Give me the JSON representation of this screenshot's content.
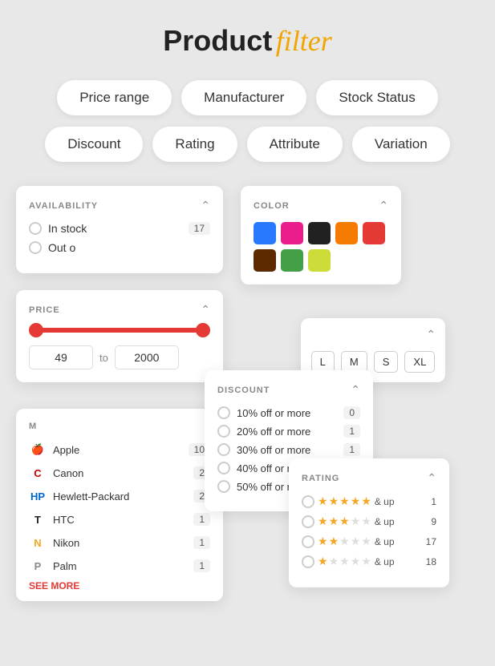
{
  "title": {
    "bold": "Product",
    "italic": "filter"
  },
  "pills_row1": [
    {
      "label": "Price range"
    },
    {
      "label": "Manufacturer"
    },
    {
      "label": "Stock Status"
    }
  ],
  "pills_row2": [
    {
      "label": "Discount"
    },
    {
      "label": "Rating"
    },
    {
      "label": "Attribute"
    },
    {
      "label": "Variation"
    }
  ],
  "availability": {
    "title": "AVAILABILITY",
    "items": [
      {
        "label": "In stock",
        "count": "17"
      },
      {
        "label": "Out of",
        "count": ""
      }
    ]
  },
  "price": {
    "title": "PRICE",
    "min": "49",
    "max": "2000"
  },
  "manufacturer": {
    "title": "M",
    "items": [
      {
        "logo_color": "#999",
        "logo_text": "🍎",
        "name": "Apple",
        "count": "10"
      },
      {
        "logo_color": "#c00",
        "logo_text": "C",
        "name": "Canon",
        "count": "2"
      },
      {
        "logo_color": "#0066cc",
        "logo_text": "HP",
        "name": "Hewlett-Packard",
        "count": "2"
      },
      {
        "logo_color": "#222",
        "logo_text": "T",
        "name": "HTC",
        "count": "1"
      },
      {
        "logo_color": "#f5a623",
        "logo_text": "N",
        "name": "Nikon",
        "count": "1"
      },
      {
        "logo_color": "#888",
        "logo_text": "P",
        "name": "Palm",
        "count": "1"
      }
    ],
    "see_more": "SEE MORE"
  },
  "color": {
    "title": "COLOR",
    "swatches": [
      "#2979FF",
      "#e91e8c",
      "#212121",
      "#f57c00",
      "#e53935",
      "#5d2a00",
      "#43a047",
      "#cddc39"
    ]
  },
  "size": {
    "sizes": [
      "L",
      "M",
      "S",
      "XL"
    ]
  },
  "discount": {
    "title": "DISCOUNT",
    "items": [
      {
        "label": "10% off or more",
        "count": "0"
      },
      {
        "label": "20% off or more",
        "count": "1"
      },
      {
        "label": "30% off or more",
        "count": "1"
      },
      {
        "label": "40% off or more",
        "count": ""
      },
      {
        "label": "50% off or more",
        "count": ""
      }
    ]
  },
  "rating": {
    "title": "RATING",
    "items": [
      {
        "stars": [
          1,
          1,
          1,
          1,
          0.5
        ],
        "label": "& up",
        "count": "1"
      },
      {
        "stars": [
          1,
          1,
          1,
          0,
          0
        ],
        "label": "& up",
        "count": "9"
      },
      {
        "stars": [
          1,
          1,
          0,
          0,
          0
        ],
        "label": "& up",
        "count": "17"
      },
      {
        "stars": [
          1,
          0,
          0,
          0,
          0
        ],
        "label": "& up",
        "count": "18"
      }
    ]
  }
}
